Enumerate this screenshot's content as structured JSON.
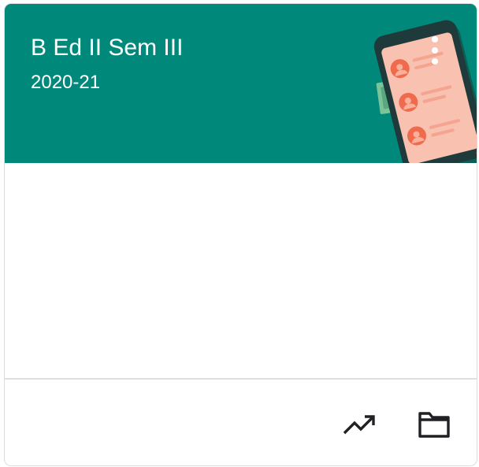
{
  "class_card": {
    "title": "B Ed II Sem III",
    "section": "2020-21",
    "header_color": "#00897b",
    "illustration": "phone-contacts-illustration",
    "actions": {
      "more_icon": "more-vert-icon",
      "gradebook_icon": "trending-up-icon",
      "drive_folder_icon": "folder-icon"
    }
  }
}
